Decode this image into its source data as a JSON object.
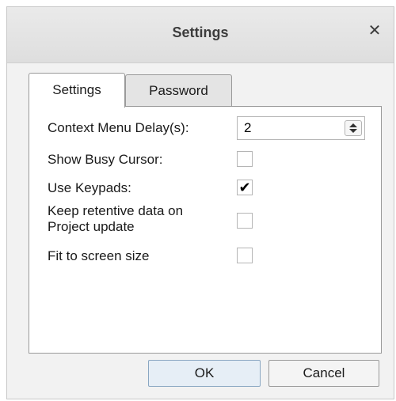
{
  "dialog": {
    "title": "Settings",
    "close_glyph": "✕",
    "close_icon": "close-icon"
  },
  "tabs": [
    {
      "label": "Settings",
      "active": true
    },
    {
      "label": "Password",
      "active": false
    }
  ],
  "settings": {
    "context_menu_delay": {
      "label": "Context Menu Delay(s):",
      "value": "2"
    },
    "show_busy_cursor": {
      "label": "Show Busy Cursor:",
      "checked": false
    },
    "use_keypads": {
      "label": "Use Keypads:",
      "checked": true,
      "check_glyph": "✔"
    },
    "keep_retentive": {
      "label_line1": "Keep retentive data on",
      "label_line2": "Project update",
      "checked": false
    },
    "fit_to_screen": {
      "label": "Fit to screen size",
      "checked": false
    }
  },
  "buttons": {
    "ok": "OK",
    "cancel": "Cancel"
  },
  "colors": {
    "titlebar": "#e4e4e4",
    "ok_button": "#e6eef6",
    "border": "#9a9a9a"
  }
}
